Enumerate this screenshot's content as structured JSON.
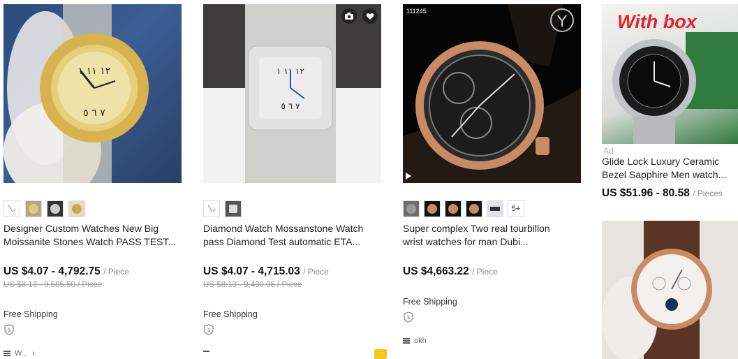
{
  "products": [
    {
      "title_line1": "Designer Custom Watches New Big",
      "title_line2": "Moissanite Stones Watch PASS TEST...",
      "price": "US $4.07 - 4,792.75",
      "unit": "/ Piece",
      "original_price": "US $8.13 - 9,585.50 / Piece",
      "shipping": "Free Shipping",
      "store": "W...",
      "store_arrow": "›"
    },
    {
      "title_line1": "Diamond Watch Mossanstone Watch",
      "title_line2": "pass Diamond Test automatic ETA...",
      "price": "US $4.07 - 4,715.03",
      "unit": "/ Piece",
      "original_price": "US $8.13 - 9,430.06 / Piece",
      "shipping": "Free Shipping"
    },
    {
      "image_label": "111245",
      "title_line1": "Super complex Two real tourbillon",
      "title_line2": "wrist watches for man Dubi...",
      "price": "US $4,663.22",
      "unit": "/ Piece",
      "shipping": "Free Shipping",
      "more_thumbs": "5+",
      "store": "okh"
    },
    {
      "banner": "With box",
      "ad_label": "Ad",
      "title_line1": "Glide Lock Luxury Ceramic",
      "title_line2": "Bezel Sapphire Men watch...",
      "price": "US $51.96 - 80.58",
      "unit": "/ Pieces"
    }
  ],
  "icons": {
    "camera": "camera-icon",
    "favorite": "heart-icon",
    "play": "play-icon",
    "shield": "shield-icon",
    "menu": "menu-icon",
    "more": "ellipsis-icon"
  },
  "colors": {
    "banner_red": "#e8232b",
    "more_badge": "#f5c518"
  }
}
